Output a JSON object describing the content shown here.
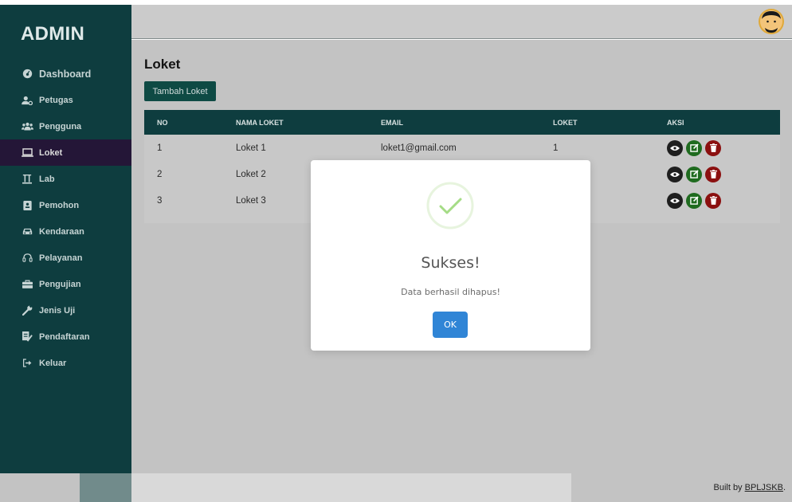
{
  "sidebar": {
    "brand": "ADMIN",
    "items": [
      {
        "label": "Dashboard",
        "icon": "dashboard-icon"
      },
      {
        "label": "Petugas",
        "icon": "users-cog-icon"
      },
      {
        "label": "Pengguna",
        "icon": "users-icon"
      },
      {
        "label": "Loket",
        "icon": "laptop-icon",
        "active": true
      },
      {
        "label": "Lab",
        "icon": "flask-icon"
      },
      {
        "label": "Pemohon",
        "icon": "id-card-icon"
      },
      {
        "label": "Kendaraan",
        "icon": "car-icon"
      },
      {
        "label": "Pelayanan",
        "icon": "headset-icon"
      },
      {
        "label": "Pengujian",
        "icon": "toolbox-icon"
      },
      {
        "label": "Jenis Uji",
        "icon": "wrench-icon"
      },
      {
        "label": "Pendaftaran",
        "icon": "signature-icon"
      },
      {
        "label": "Keluar",
        "icon": "sign-out-icon"
      }
    ]
  },
  "header": {
    "avatar_icon": "user-avatar-icon"
  },
  "main": {
    "title": "Loket",
    "add_button": "Tambah Loket",
    "table": {
      "columns": [
        "NO",
        "NAMA LOKET",
        "EMAIL",
        "LOKET",
        "AKSI"
      ],
      "rows": [
        {
          "no": "1",
          "nama": "Loket 1",
          "email": "loket1@gmail.com",
          "loket": "1"
        },
        {
          "no": "2",
          "nama": "Loket 2",
          "email": "",
          "loket": ""
        },
        {
          "no": "3",
          "nama": "Loket 3",
          "email": "",
          "loket": ""
        }
      ],
      "action_icons": [
        "eye-icon",
        "edit-icon",
        "trash-icon"
      ]
    }
  },
  "modal": {
    "icon": "success-check-icon",
    "title": "Sukses!",
    "text": "Data berhasil dihapus!",
    "ok_button": "OK"
  },
  "footer": {
    "built_prefix": "Built by ",
    "built_link": "BPLJSKB",
    "built_suffix": "."
  },
  "colors": {
    "sidebar": "#0e3d3f",
    "active_menu": "#241637",
    "table_header": "#0e3d3f",
    "ok_button": "#3085d6",
    "success": "#a5dc86",
    "view": "#1e1e1e",
    "edit": "#1f6b1f",
    "delete": "#8b1010"
  }
}
